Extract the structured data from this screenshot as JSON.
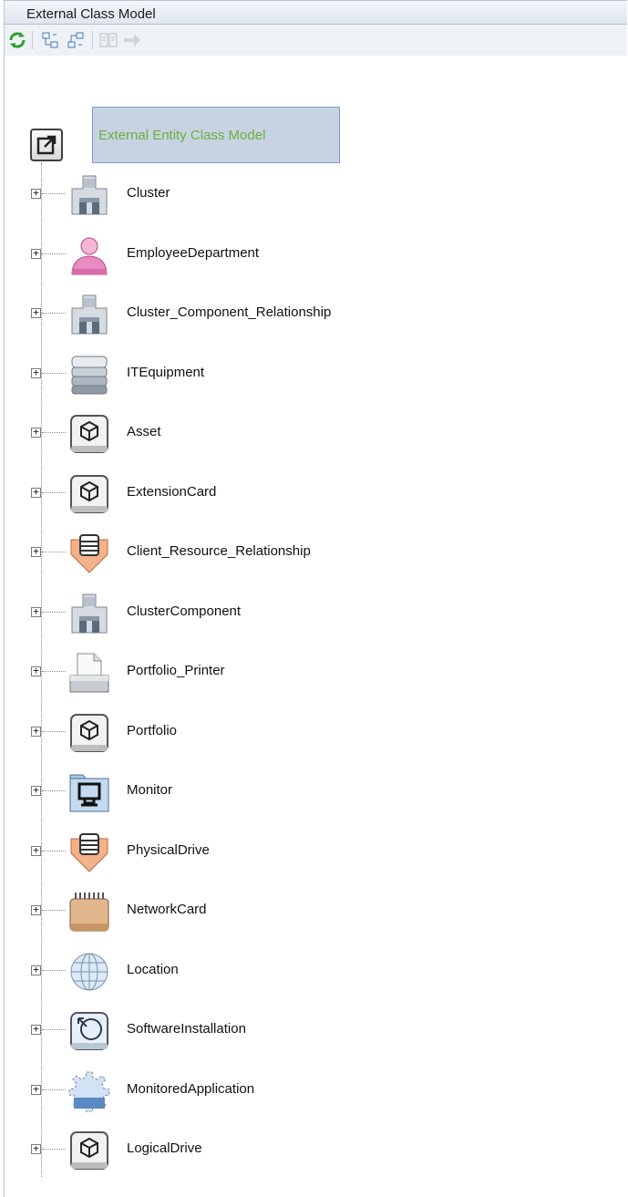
{
  "panel": {
    "title": "External Class Model"
  },
  "toolbar": {
    "buttons": [
      {
        "name": "refresh-icon"
      },
      {
        "name": "expand-all-icon"
      },
      {
        "name": "collapse-all-icon"
      },
      {
        "name": "properties-icon"
      },
      {
        "name": "navigate-arrow-icon"
      }
    ]
  },
  "tree": {
    "root_label": "External Entity Class Model",
    "items": [
      {
        "label": "Cluster",
        "icon": "cluster-icon"
      },
      {
        "label": "EmployeeDepartment",
        "icon": "person-icon"
      },
      {
        "label": "Cluster_Component_Relationship",
        "icon": "cluster-icon"
      },
      {
        "label": "ITEquipment",
        "icon": "stack-icon"
      },
      {
        "label": "Asset",
        "icon": "cube-icon"
      },
      {
        "label": "ExtensionCard",
        "icon": "cube-icon"
      },
      {
        "label": "Client_Resource_Relationship",
        "icon": "server-arrow-icon"
      },
      {
        "label": "ClusterComponent",
        "icon": "cluster-icon"
      },
      {
        "label": "Portfolio_Printer",
        "icon": "printer-icon"
      },
      {
        "label": "Portfolio",
        "icon": "cube-icon"
      },
      {
        "label": "Monitor",
        "icon": "monitor-icon"
      },
      {
        "label": "PhysicalDrive",
        "icon": "server-arrow-icon"
      },
      {
        "label": "NetworkCard",
        "icon": "network-card-icon"
      },
      {
        "label": "Location",
        "icon": "globe-icon"
      },
      {
        "label": "SoftwareInstallation",
        "icon": "install-icon"
      },
      {
        "label": "MonitoredApplication",
        "icon": "gear-icon"
      },
      {
        "label": "LogicalDrive",
        "icon": "cube-icon"
      }
    ]
  },
  "colors": {
    "root_label_text": "#6dae3a",
    "root_label_bg": "#c7d3e3",
    "person_icon": "#e88bc0",
    "server_arrow_icon": "#f3b28a",
    "network_card_icon": "#e2b68c"
  }
}
